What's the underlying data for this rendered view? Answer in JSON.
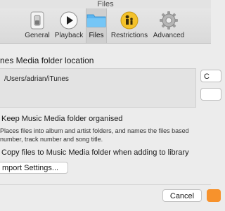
{
  "window": {
    "title": "Files"
  },
  "toolbar": {
    "tabs": [
      {
        "label": "General",
        "icon": "switch-icon"
      },
      {
        "label": "Playback",
        "icon": "play-icon"
      },
      {
        "label": "Files",
        "icon": "folder-icon"
      },
      {
        "label": "Restrictions",
        "icon": "parental-restrictions-icon"
      },
      {
        "label": "Advanced",
        "icon": "gear-icon"
      }
    ],
    "active_tab": "Files"
  },
  "files": {
    "location_title": "nes Media folder location",
    "location_path": "/Users/adrian/iTunes",
    "change_button_label": "C",
    "keep_organised_label": "Keep Music Media folder organised",
    "keep_organised_desc_line1": "Places files into album and artist folders, and names the files based",
    "keep_organised_desc_line2": "number, track number and song title.",
    "copy_files_label": "Copy files to Music Media folder when adding to library",
    "import_settings_label": "mport Settings..."
  },
  "footer": {
    "cancel_label": "Cancel"
  },
  "colors": {
    "accent_ok": "#f7922c",
    "folder_blue": "#5ab4ef",
    "restrictions_yellow": "#f4c22b"
  }
}
